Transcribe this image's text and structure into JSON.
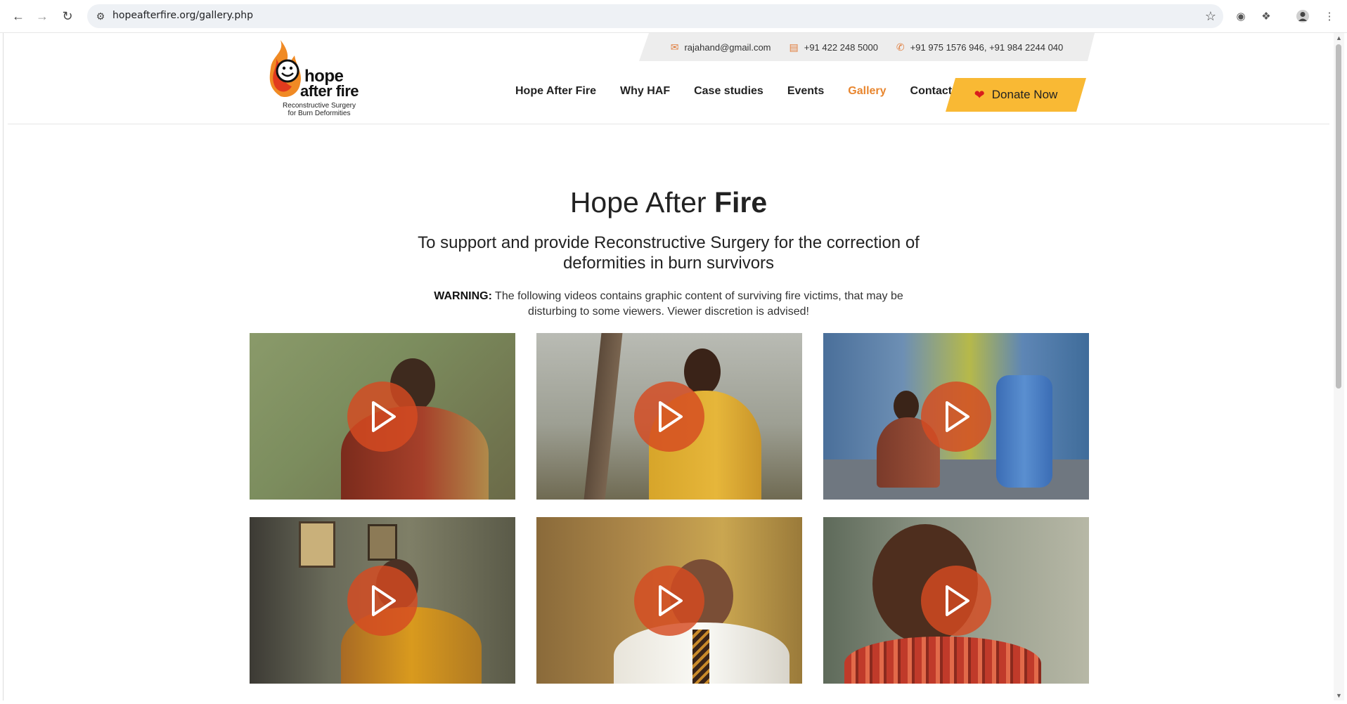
{
  "browser": {
    "url": "hopeafterfire.org/gallery.php"
  },
  "contact": {
    "email": "rajahand@gmail.com",
    "phone": "+91 422 248 5000",
    "mobile": "+91 975 1576 946, +91 984 2244 040"
  },
  "logo": {
    "line1": "hope",
    "line2": "after fire",
    "tagline_1": "Reconstructive Surgery",
    "tagline_2": "for Burn Deformities"
  },
  "nav": {
    "items": [
      "Hope After Fire",
      "Why HAF",
      "Case studies",
      "Events",
      "Gallery",
      "Contact"
    ],
    "active": "Gallery",
    "donate_label": "Donate Now"
  },
  "hero": {
    "title_normal": "Hope After ",
    "title_bold": "Fire",
    "subtitle": "To support and provide Reconstructive Surgery for the correction of deformities in burn survivors",
    "warning_label": "WARNING:",
    "warning_text": " The following videos contains graphic content of surviving fire victims, that may be disturbing to some viewers. Viewer discretion is advised!"
  },
  "colors": {
    "accent": "#e8862f",
    "donate_bg": "#f9b934",
    "play": "#d64a21"
  }
}
